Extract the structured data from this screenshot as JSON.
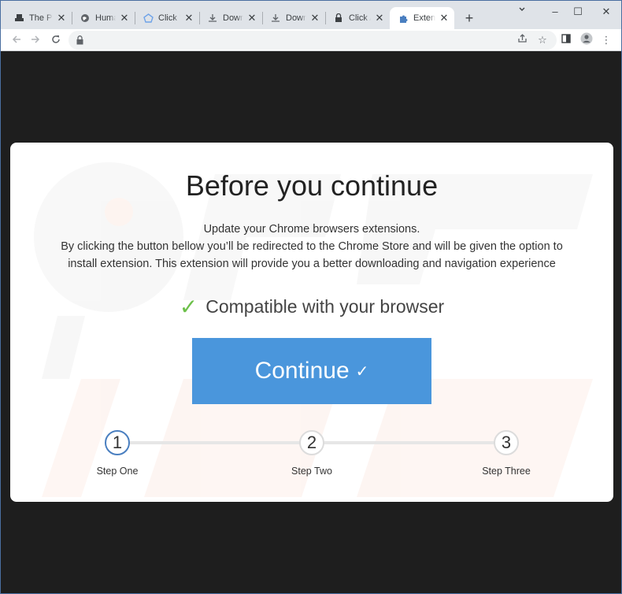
{
  "browser": {
    "tabs": [
      {
        "title": "The Pirate",
        "icon": "ship-icon"
      },
      {
        "title": "Human",
        "icon": "globe-icon"
      },
      {
        "title": "Click \"Continue\"",
        "icon": "shape-icon"
      },
      {
        "title": "Download",
        "icon": "download-icon"
      },
      {
        "title": "Download",
        "icon": "download-icon"
      },
      {
        "title": "Click Allow",
        "icon": "lock-icon"
      },
      {
        "title": "Extension",
        "icon": "puzzle-icon",
        "active": true
      }
    ],
    "window_controls": {
      "minimize": "–",
      "maximize": "☐",
      "close": "✕"
    },
    "new_tab": "+"
  },
  "page": {
    "headline": "Before you continue",
    "description_lines": [
      "Update your Chrome browsers extensions.",
      "By clicking the button bellow you’ll be redirected to the Chrome Store and will be given the option to",
      "install extension. This extension will provide you a better downloading and navigation experience"
    ],
    "compatible_check": "✓",
    "compatible_text": "Compatible with your browser",
    "continue_label": "Continue",
    "continue_check": "✓",
    "steps": [
      {
        "number": "1",
        "label": "Step One",
        "active": true
      },
      {
        "number": "2",
        "label": "Step Two",
        "active": false
      },
      {
        "number": "3",
        "label": "Step Three",
        "active": false
      }
    ],
    "watermark": "risk.com",
    "colors": {
      "button": "#4a96dc",
      "check": "#6cc04a",
      "active_step_border": "#4a7fc0",
      "background": "#1e1e1e"
    }
  }
}
